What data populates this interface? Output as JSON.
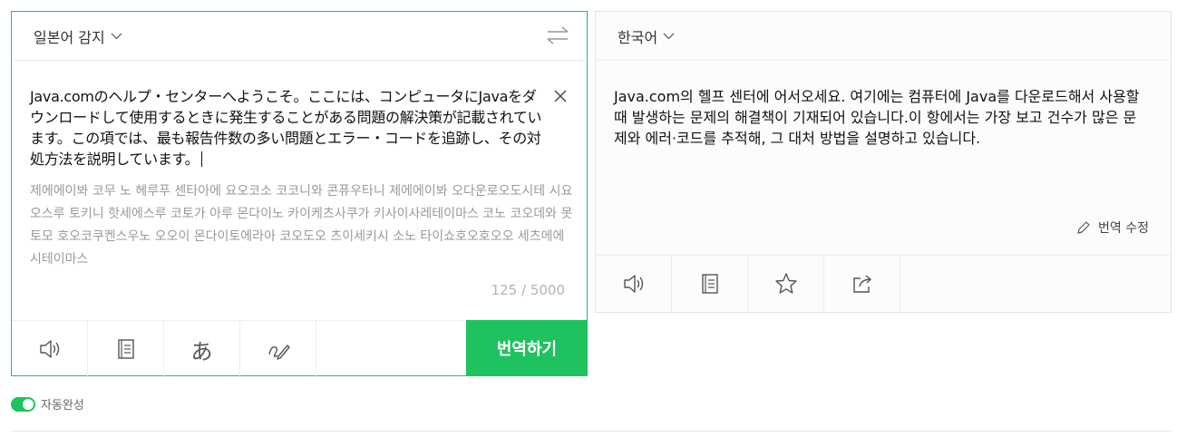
{
  "source": {
    "language_label": "일본어 감지",
    "text": "Java.comのヘルプ・センターへようこそ。ここには、コンピュータにJavaをダウンロードして使用するときに発生することがある問題の解決策が記載されています。この項では、最も報告件数の多い問題とエラー・コードを追跡し、その対処方法を説明しています。",
    "pronunciation": "제에에이봐 코무 노 헤루푸 센타아에 요오코소 코코니와 콘퓨우타니 제에에이봐 오다운로오도시테 시요오스루 토키니 핫세에스루 코토가 아루 몬다이노 카이케츠사쿠가 키사이사레테이마스 코노 코오데와 못토모 호오코쿠켄스우노 오오이 몬다이토에라아 코오도오 츠이세키시 소노 타이쇼호오호오오 세츠메에시테이마스",
    "counter": "125 / 5000",
    "translate_label": "번역하기"
  },
  "target": {
    "language_label": "한국어",
    "text": "Java.com의 헬프 센터에 어서오세요. 여기에는 컴퓨터에 Java를 다운로드해서 사용할 때 발생하는 문제의 해결책이 기재되어 있습니다.이 항에서는 가장 보고 건수가 많은 문제와 에러·코드를 추적해, 그 대처 방법을 설명하고 있습니다.",
    "edit_label": "번역 수정"
  },
  "autocomplete": {
    "label": "자동완성",
    "enabled": true
  },
  "colors": {
    "accent": "#1ec35f"
  },
  "icons": {
    "source_toolbar": [
      "speaker-icon",
      "notebook-icon",
      "japanese-keyboard-icon",
      "handwriting-icon"
    ],
    "target_toolbar": [
      "speaker-icon",
      "notebook-icon",
      "star-icon",
      "share-icon"
    ]
  }
}
